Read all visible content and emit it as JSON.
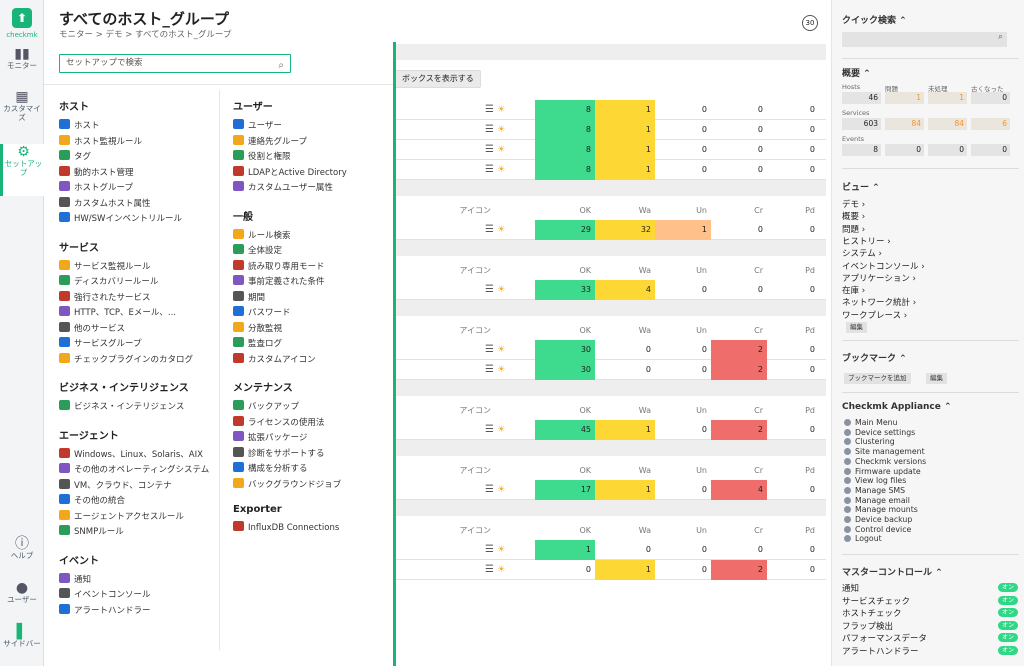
{
  "app": {
    "logo_text": "checkmk"
  },
  "leftnav": [
    {
      "label": "モニター",
      "icon": "monitor-icon"
    },
    {
      "label": "カスタマイズ",
      "icon": "customize-icon"
    },
    {
      "label": "セットアップ",
      "icon": "setup-icon"
    },
    {
      "label": "ヘルプ",
      "icon": "help-icon"
    },
    {
      "label": "ユーザー",
      "icon": "user-icon"
    },
    {
      "label": "サイドバー",
      "icon": "sidebar-icon"
    }
  ],
  "header": {
    "title": "すべてのホスト_グループ",
    "breadcrumb": "モニター > デモ > すべてのホスト_グループ",
    "refresh": "30"
  },
  "main": {
    "button_label": "ボックスを表示する",
    "columns": [
      "アイコン",
      "OK",
      "Wa",
      "Un",
      "Cr",
      "Pd"
    ],
    "groups": [
      {
        "header": false,
        "rows": [
          [
            "8",
            "1",
            "0",
            "0",
            "0"
          ],
          [
            "8",
            "1",
            "0",
            "0",
            "0"
          ],
          [
            "8",
            "1",
            "0",
            "0",
            "0"
          ],
          [
            "8",
            "1",
            "0",
            "0",
            "0"
          ]
        ]
      },
      {
        "header": true,
        "rows": [
          [
            "29",
            "32",
            "1",
            "0",
            "0"
          ]
        ]
      },
      {
        "header": true,
        "rows": [
          [
            "33",
            "4",
            "0",
            "0",
            "0"
          ]
        ]
      },
      {
        "header": true,
        "rows": [
          [
            "30",
            "0",
            "0",
            "2",
            "0"
          ],
          [
            "30",
            "0",
            "0",
            "2",
            "0"
          ]
        ]
      },
      {
        "header": true,
        "rows": [
          [
            "45",
            "1",
            "0",
            "2",
            "0"
          ]
        ]
      },
      {
        "header": true,
        "rows": [
          [
            "17",
            "1",
            "0",
            "4",
            "0"
          ]
        ]
      },
      {
        "header": true,
        "rows": [
          [
            "1",
            "0",
            "0",
            "0",
            "0"
          ],
          [
            "0",
            "1",
            "0",
            "2",
            "0"
          ]
        ]
      }
    ]
  },
  "setup_menu": {
    "search_placeholder": "セットアップで検索",
    "col1": [
      {
        "heading": "ホスト",
        "items": [
          "ホスト",
          "ホスト監視ルール",
          "タグ",
          "動的ホスト管理",
          "ホストグループ",
          "カスタムホスト属性",
          "HW/SWインベントリルール"
        ]
      },
      {
        "heading": "サービス",
        "items": [
          "サービス監視ルール",
          "ディスカバリールール",
          "強行されたサービス",
          "HTTP、TCP、Eメール、...",
          "他のサービス",
          "サービスグループ",
          "チェックプラグインのカタログ"
        ]
      },
      {
        "heading": "ビジネス・インテリジェンス",
        "items": [
          "ビジネス・インテリジェンス"
        ]
      },
      {
        "heading": "エージェント",
        "items": [
          "Windows、Linux、Solaris、AIX",
          "その他のオペレーティングシステム",
          "VM、クラウド、コンテナ",
          "その他の統合",
          "エージェントアクセスルール",
          "SNMPルール"
        ]
      },
      {
        "heading": "イベント",
        "items": [
          "通知",
          "イベントコンソール",
          "アラートハンドラー"
        ]
      }
    ],
    "col2": [
      {
        "heading": "ユーザー",
        "items": [
          "ユーザー",
          "連絡先グループ",
          "役割と権限",
          "LDAPとActive Directory",
          "カスタムユーザー属性"
        ]
      },
      {
        "heading": "一般",
        "items": [
          "ルール検索",
          "全体設定",
          "読み取り専用モード",
          "事前定義された条件",
          "期間",
          "パスワード",
          "分散監視",
          "監査ログ",
          "カスタムアイコン"
        ]
      },
      {
        "heading": "メンテナンス",
        "items": [
          "バックアップ",
          "ライセンスの使用法",
          "拡張パッケージ",
          "診断をサポートする",
          "構成を分析する",
          "バックグラウンドジョブ"
        ]
      },
      {
        "heading": "Exporter",
        "items": [
          "InfluxDB Connections"
        ]
      }
    ]
  },
  "sidebar": {
    "quick_search": "クイック検索",
    "overview": {
      "title": "概要",
      "cols": [
        "問題",
        "未処理",
        "古くなった"
      ],
      "rows": [
        {
          "label": "Hosts",
          "values": [
            "46",
            "1",
            "1",
            "0"
          ]
        },
        {
          "label": "Services",
          "values": [
            "603",
            "84",
            "84",
            "6"
          ]
        },
        {
          "label": "Events",
          "values": [
            "8",
            "0",
            "0",
            "0"
          ]
        }
      ]
    },
    "views": {
      "title": "ビュー",
      "items": [
        "デモ",
        "概要",
        "問題",
        "ヒストリー",
        "システム",
        "イベントコンソール",
        "アプリケーション",
        "在庫",
        "ネットワーク統計",
        "ワークプレース"
      ],
      "edit": "編集"
    },
    "bookmarks": {
      "title": "ブックマーク",
      "add": "ブックマークを追加",
      "edit": "編集"
    },
    "appliance": {
      "title": "Checkmk Appliance",
      "items": [
        "Main Menu",
        "Device settings",
        "Clustering",
        "Site management",
        "Checkmk versions",
        "Firmware update",
        "View log files",
        "Manage SMS",
        "Manage email",
        "Manage mounts",
        "Device backup",
        "Control device",
        "Logout"
      ]
    },
    "master": {
      "title": "マスターコントロール",
      "items": [
        "通知",
        "サービスチェック",
        "ホストチェック",
        "フラップ検出",
        "パフォーマンスデータ",
        "アラートハンドラー"
      ],
      "state": "オン"
    }
  },
  "colors": {
    "ok": "#3edb8f",
    "warn": "#fdd835",
    "unknown": "#ffc08a",
    "crit": "#ef6e6b",
    "accent": "#19b478"
  }
}
